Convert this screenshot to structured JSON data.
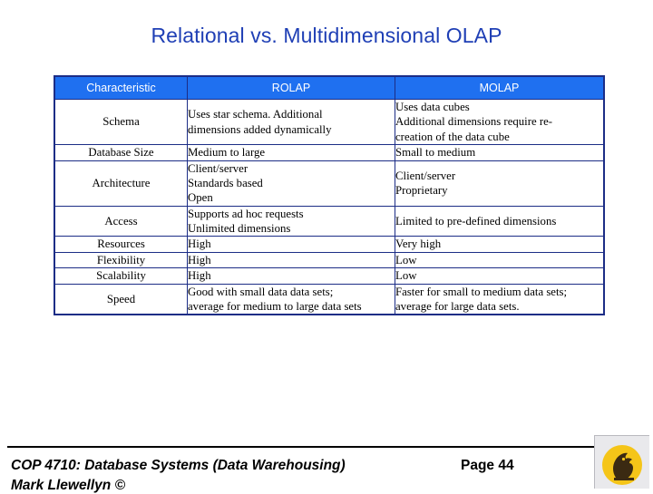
{
  "slide": {
    "title": "Relational vs. Multidimensional OLAP",
    "accent_header_bg": "#1f70f0",
    "title_color": "#1f3fb5",
    "table_border_color": "#1c2d86"
  },
  "table": {
    "headers": [
      "Characteristic",
      "ROLAP",
      "MOLAP"
    ],
    "rows": [
      {
        "characteristic": "Schema",
        "rolap": [
          "Uses star schema.  Additional",
          "dimensions added dynamically"
        ],
        "molap": [
          "Uses data cubes",
          "Additional dimensions require re-",
          "creation of the data cube"
        ]
      },
      {
        "characteristic": "Database Size",
        "rolap": [
          "Medium to large"
        ],
        "molap": [
          "Small to medium"
        ]
      },
      {
        "characteristic": "Architecture",
        "rolap": [
          "Client/server",
          "Standards based",
          "Open"
        ],
        "molap": [
          "Client/server",
          "Proprietary"
        ]
      },
      {
        "characteristic": "Access",
        "rolap": [
          "Supports ad hoc requests",
          "Unlimited dimensions"
        ],
        "molap": [
          "Limited to pre-defined dimensions"
        ]
      },
      {
        "characteristic": "Resources",
        "rolap": [
          "High"
        ],
        "molap": [
          "Very high"
        ]
      },
      {
        "characteristic": "Flexibility",
        "rolap": [
          "High"
        ],
        "molap": [
          "Low"
        ]
      },
      {
        "characteristic": "Scalability",
        "rolap": [
          "High"
        ],
        "molap": [
          "Low"
        ]
      },
      {
        "characteristic": "Speed",
        "rolap": [
          "Good with small data data sets;",
          "average for medium to large data sets"
        ],
        "molap": [
          "Faster for small to medium data sets;",
          "average for large data sets."
        ]
      }
    ]
  },
  "footer": {
    "course": "COP 4710: Database Systems  (Data Warehousing)",
    "page": "Page 44",
    "author": "Mark Llewellyn ©"
  }
}
